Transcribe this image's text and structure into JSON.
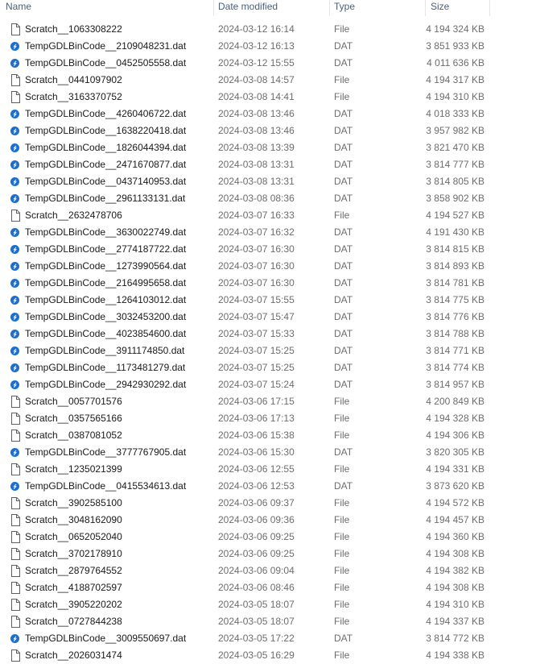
{
  "columns": {
    "name": "Name",
    "date": "Date modified",
    "type": "Type",
    "size": "Size"
  },
  "colors": {
    "header_text": "#4c607a",
    "dat_icon": "#1c6ecf",
    "detail_text": "#6d6d6d"
  },
  "files": [
    {
      "name": "Scratch__1063308222",
      "date": "2024-03-12 16:14",
      "type": "File",
      "size": "4 194 324 KB",
      "icon": "blank-file-icon"
    },
    {
      "name": "TempGDLBinCode__2109048231.dat",
      "date": "2024-03-12 16:13",
      "type": "DAT",
      "size": "3 851 933 KB",
      "icon": "dat-file-icon"
    },
    {
      "name": "TempGDLBinCode__0452505558.dat",
      "date": "2024-03-12 15:55",
      "type": "DAT",
      "size": "4 011 636 KB",
      "icon": "dat-file-icon"
    },
    {
      "name": "Scratch__0441097902",
      "date": "2024-03-08 14:57",
      "type": "File",
      "size": "4 194 317 KB",
      "icon": "blank-file-icon"
    },
    {
      "name": "Scratch__3163370752",
      "date": "2024-03-08 14:41",
      "type": "File",
      "size": "4 194 310 KB",
      "icon": "blank-file-icon"
    },
    {
      "name": "TempGDLBinCode__4260406722.dat",
      "date": "2024-03-08 13:46",
      "type": "DAT",
      "size": "4 018 333 KB",
      "icon": "dat-file-icon"
    },
    {
      "name": "TempGDLBinCode__1638220418.dat",
      "date": "2024-03-08 13:46",
      "type": "DAT",
      "size": "3 957 982 KB",
      "icon": "dat-file-icon"
    },
    {
      "name": "TempGDLBinCode__1826044394.dat",
      "date": "2024-03-08 13:39",
      "type": "DAT",
      "size": "3 821 470 KB",
      "icon": "dat-file-icon"
    },
    {
      "name": "TempGDLBinCode__2471670877.dat",
      "date": "2024-03-08 13:31",
      "type": "DAT",
      "size": "3 814 777 KB",
      "icon": "dat-file-icon"
    },
    {
      "name": "TempGDLBinCode__0437140953.dat",
      "date": "2024-03-08 13:31",
      "type": "DAT",
      "size": "3 814 805 KB",
      "icon": "dat-file-icon"
    },
    {
      "name": "TempGDLBinCode__2961133131.dat",
      "date": "2024-03-08 08:36",
      "type": "DAT",
      "size": "3 858 902 KB",
      "icon": "dat-file-icon"
    },
    {
      "name": "Scratch__2632478706",
      "date": "2024-03-07 16:33",
      "type": "File",
      "size": "4 194 527 KB",
      "icon": "blank-file-icon"
    },
    {
      "name": "TempGDLBinCode__3630022749.dat",
      "date": "2024-03-07 16:32",
      "type": "DAT",
      "size": "4 191 430 KB",
      "icon": "dat-file-icon"
    },
    {
      "name": "TempGDLBinCode__2774187722.dat",
      "date": "2024-03-07 16:30",
      "type": "DAT",
      "size": "3 814 815 KB",
      "icon": "dat-file-icon"
    },
    {
      "name": "TempGDLBinCode__1273990564.dat",
      "date": "2024-03-07 16:30",
      "type": "DAT",
      "size": "3 814 893 KB",
      "icon": "dat-file-icon"
    },
    {
      "name": "TempGDLBinCode__2164995658.dat",
      "date": "2024-03-07 16:30",
      "type": "DAT",
      "size": "3 814 781 KB",
      "icon": "dat-file-icon"
    },
    {
      "name": "TempGDLBinCode__1264103012.dat",
      "date": "2024-03-07 15:55",
      "type": "DAT",
      "size": "3 814 775 KB",
      "icon": "dat-file-icon"
    },
    {
      "name": "TempGDLBinCode__3032453200.dat",
      "date": "2024-03-07 15:47",
      "type": "DAT",
      "size": "3 814 776 KB",
      "icon": "dat-file-icon"
    },
    {
      "name": "TempGDLBinCode__4023854600.dat",
      "date": "2024-03-07 15:33",
      "type": "DAT",
      "size": "3 814 788 KB",
      "icon": "dat-file-icon"
    },
    {
      "name": "TempGDLBinCode__3911174850.dat",
      "date": "2024-03-07 15:25",
      "type": "DAT",
      "size": "3 814 771 KB",
      "icon": "dat-file-icon"
    },
    {
      "name": "TempGDLBinCode__1173481279.dat",
      "date": "2024-03-07 15:25",
      "type": "DAT",
      "size": "3 814 774 KB",
      "icon": "dat-file-icon"
    },
    {
      "name": "TempGDLBinCode__2942930292.dat",
      "date": "2024-03-07 15:24",
      "type": "DAT",
      "size": "3 814 957 KB",
      "icon": "dat-file-icon"
    },
    {
      "name": "Scratch__0057701576",
      "date": "2024-03-06 17:15",
      "type": "File",
      "size": "4 200 849 KB",
      "icon": "blank-file-icon"
    },
    {
      "name": "Scratch__0357565166",
      "date": "2024-03-06 17:13",
      "type": "File",
      "size": "4 194 328 KB",
      "icon": "blank-file-icon"
    },
    {
      "name": "Scratch__0387081052",
      "date": "2024-03-06 15:38",
      "type": "File",
      "size": "4 194 306 KB",
      "icon": "blank-file-icon"
    },
    {
      "name": "TempGDLBinCode__3777767905.dat",
      "date": "2024-03-06 15:30",
      "type": "DAT",
      "size": "3 820 305 KB",
      "icon": "dat-file-icon"
    },
    {
      "name": "Scratch__1235021399",
      "date": "2024-03-06 12:55",
      "type": "File",
      "size": "4 194 331 KB",
      "icon": "blank-file-icon"
    },
    {
      "name": "TempGDLBinCode__0415534613.dat",
      "date": "2024-03-06 12:53",
      "type": "DAT",
      "size": "3 873 620 KB",
      "icon": "dat-file-icon"
    },
    {
      "name": "Scratch__3902585100",
      "date": "2024-03-06 09:37",
      "type": "File",
      "size": "4 194 572 KB",
      "icon": "blank-file-icon"
    },
    {
      "name": "Scratch__3048162090",
      "date": "2024-03-06 09:36",
      "type": "File",
      "size": "4 194 457 KB",
      "icon": "blank-file-icon"
    },
    {
      "name": "Scratch__0652052040",
      "date": "2024-03-06 09:25",
      "type": "File",
      "size": "4 194 360 KB",
      "icon": "blank-file-icon"
    },
    {
      "name": "Scratch__3702178910",
      "date": "2024-03-06 09:25",
      "type": "File",
      "size": "4 194 308 KB",
      "icon": "blank-file-icon"
    },
    {
      "name": "Scratch__2879764552",
      "date": "2024-03-06 09:04",
      "type": "File",
      "size": "4 194 382 KB",
      "icon": "blank-file-icon"
    },
    {
      "name": "Scratch__4188702597",
      "date": "2024-03-06 08:46",
      "type": "File",
      "size": "4 194 308 KB",
      "icon": "blank-file-icon"
    },
    {
      "name": "Scratch__3905220202",
      "date": "2024-03-05 18:07",
      "type": "File",
      "size": "4 194 310 KB",
      "icon": "blank-file-icon"
    },
    {
      "name": "Scratch__0727844238",
      "date": "2024-03-05 18:07",
      "type": "File",
      "size": "4 194 337 KB",
      "icon": "blank-file-icon"
    },
    {
      "name": "TempGDLBinCode__3009550697.dat",
      "date": "2024-03-05 17:22",
      "type": "DAT",
      "size": "3 814 772 KB",
      "icon": "dat-file-icon"
    },
    {
      "name": "Scratch__2026031474",
      "date": "2024-03-05 16:29",
      "type": "File",
      "size": "4 194 338 KB",
      "icon": "blank-file-icon"
    }
  ]
}
